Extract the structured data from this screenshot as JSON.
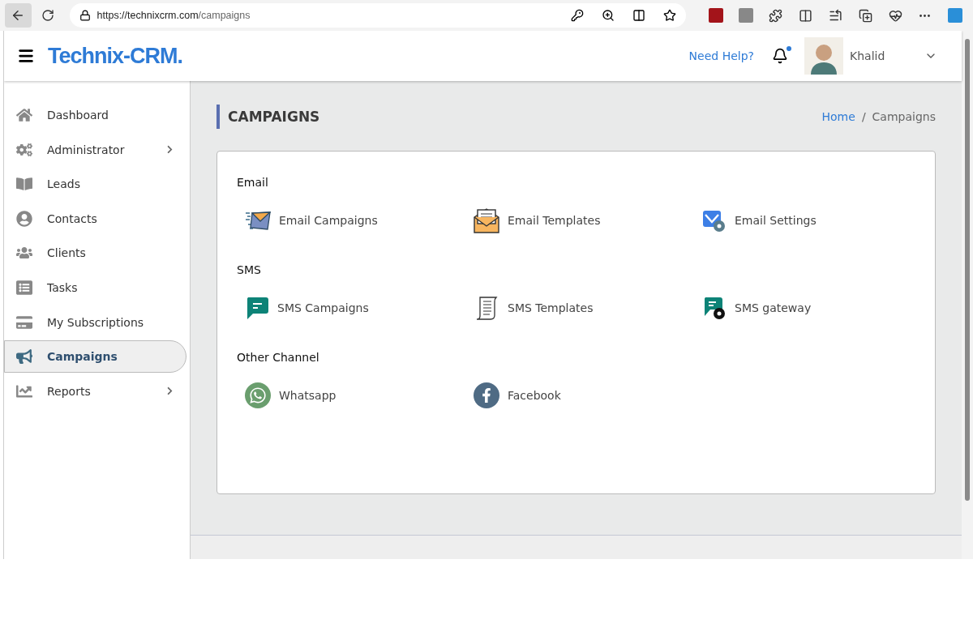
{
  "browser": {
    "url_host": "https://technixcrm.com",
    "url_path": "/campaigns"
  },
  "header": {
    "brand": "Technix-CRM.",
    "help": "Need Help?",
    "notifications_unread": true,
    "user": "Khalid"
  },
  "sidebar": {
    "items": [
      {
        "label": "Dashboard",
        "selected": false,
        "submenu": false
      },
      {
        "label": "Administrator",
        "selected": false,
        "submenu": true
      },
      {
        "label": "Leads",
        "selected": false,
        "submenu": false
      },
      {
        "label": "Contacts",
        "selected": false,
        "submenu": false
      },
      {
        "label": "Clients",
        "selected": false,
        "submenu": false
      },
      {
        "label": "Tasks",
        "selected": false,
        "submenu": false
      },
      {
        "label": "My Subscriptions",
        "selected": false,
        "submenu": false
      },
      {
        "label": "Campaigns",
        "selected": true,
        "submenu": false
      },
      {
        "label": "Reports",
        "selected": false,
        "submenu": true
      }
    ]
  },
  "page": {
    "title": "CAMPAIGNS",
    "breadcrumb": [
      {
        "label": "Home",
        "link": true
      },
      {
        "label": "Campaigns",
        "link": false
      }
    ],
    "separator": "/"
  },
  "sections": [
    {
      "title": "Email",
      "items": [
        {
          "label": "Email Campaigns"
        },
        {
          "label": "Email Templates"
        },
        {
          "label": "Email Settings"
        }
      ]
    },
    {
      "title": "SMS",
      "items": [
        {
          "label": "SMS Campaigns"
        },
        {
          "label": "SMS Templates"
        },
        {
          "label": "SMS gateway"
        }
      ]
    },
    {
      "title": "Other Channel",
      "items": [
        {
          "label": "Whatsapp"
        },
        {
          "label": "Facebook"
        }
      ]
    }
  ]
}
